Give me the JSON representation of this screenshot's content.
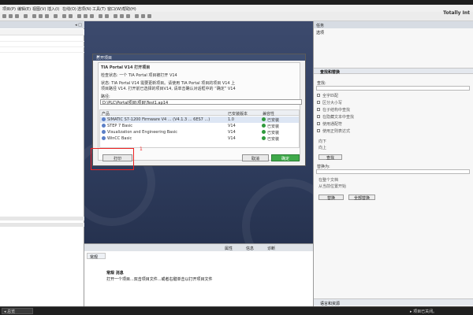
{
  "app": {
    "brand": "Totally Int"
  },
  "menu": [
    "项目(P)",
    "编辑(E)",
    "视图(V)",
    "插入(I)",
    "在线(O)",
    "选项(N)",
    "工具(T)",
    "窗口(W)",
    "帮助(H)"
  ],
  "left_pane": {
    "pin": "◂ □"
  },
  "dialog": {
    "title": "打开项目",
    "heading": "TIA Portal V14 打开项目",
    "line1": "检查状态: 一个 TIA Portal 项目被打开 V14",
    "line2": "状态: TIA Portal V14 需要更新项目。请使用 TIA Portal 项目的项目 V14 上",
    "line3": "项目路径 V14. 打开前已选择的项目V14, 请单击确认对话框中的 “确定” V14",
    "path_label": "路径:",
    "path_value": "D:\\PLC\\Portal项目\\项目\\Test1.ap14",
    "columns": [
      "产品",
      "已安装版本",
      "兼容性"
    ],
    "rows": [
      {
        "name": "SIMATIC S7-1200 Firmware V4 ... (V4.1.3 ... 6ES7 ...)",
        "version": "1.0",
        "status": "已安装"
      },
      {
        "name": "STEP 7 Basic",
        "version": "V14",
        "status": "已安装"
      },
      {
        "name": "Visualization and Engineering Basic",
        "version": "V14",
        "status": "已安装"
      },
      {
        "name": "WinCC Basic",
        "version": "V14",
        "status": "已安装"
      }
    ],
    "left_button": "打印",
    "cancel_button": "取消",
    "ok_button": "确定",
    "annotation": "1"
  },
  "bottom": {
    "tabs": [
      "属性",
      "信息",
      "诊断"
    ],
    "panel_tab": "常规",
    "message_title": "常规 消息",
    "message_text": "打开一个项目...双击项目文件...或者右键单击以打开项目文件"
  },
  "right_pane": {
    "title": "任务",
    "subtitle": "选项",
    "section": "查找和替换",
    "find_label": "查找:",
    "checkboxes": [
      "全字匹配",
      "区分大小写",
      "在子结构中查找",
      "在隐藏文本中查找",
      "使用通配符",
      "使用正则表达式"
    ],
    "up_label": "向下",
    "down_label": "向上",
    "find_button": "查找",
    "replace_label": "替换为:",
    "radio_options": [
      "在整个文档",
      "从当前位置开始"
    ],
    "replace_button": "替换",
    "replace_all_button": "全部替换",
    "bottom_section": "语言和资源"
  },
  "status_bar": {
    "left": "◂ 总览",
    "right": "▸ 项目已关闭。"
  },
  "colors": {
    "canvas": "#3c4a6d",
    "title_bar": "#3f4f72",
    "ok_green": "#3fa94a",
    "annotation_red": "#e22222"
  }
}
